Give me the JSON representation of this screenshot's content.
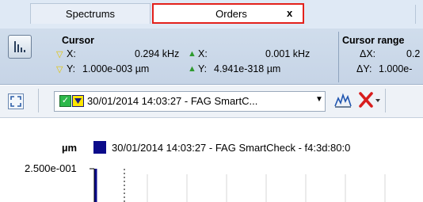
{
  "tabs": [
    {
      "label": "Spectrums"
    },
    {
      "label": "Orders",
      "close": "x"
    }
  ],
  "cursor": {
    "title": "Cursor",
    "x_label": "X:",
    "x_value": "0.294 kHz",
    "dx_label": "X:",
    "dx_value": "0.001 kHz",
    "y_label": "Y:",
    "y_value": "1.000e-003 µm",
    "dy_label": "Y:",
    "dy_value": "4.941e-318 µm"
  },
  "cursor_range": {
    "title": "Cursor range",
    "dx_label": "ΔX:",
    "dx_value": "0.2",
    "dy_label": "ΔY:",
    "dy_value": "1.000e-"
  },
  "toolbar": {
    "measurement": "30/01/2014 14:03:27 - FAG SmartC..."
  },
  "plot": {
    "unit": "µm",
    "legend": "30/01/2014 14:03:27 - FAG SmartCheck - f4:3d:80:0",
    "y_tick": "2.500e-001"
  },
  "colors": {
    "series": "#0b0b8a",
    "tab_highlight": "#e3211c"
  },
  "icons": [
    "chart-view-icon",
    "fit-view-icon",
    "spectrum-tool-icon",
    "delete-icon",
    "dropdown-arrow-icon"
  ]
}
